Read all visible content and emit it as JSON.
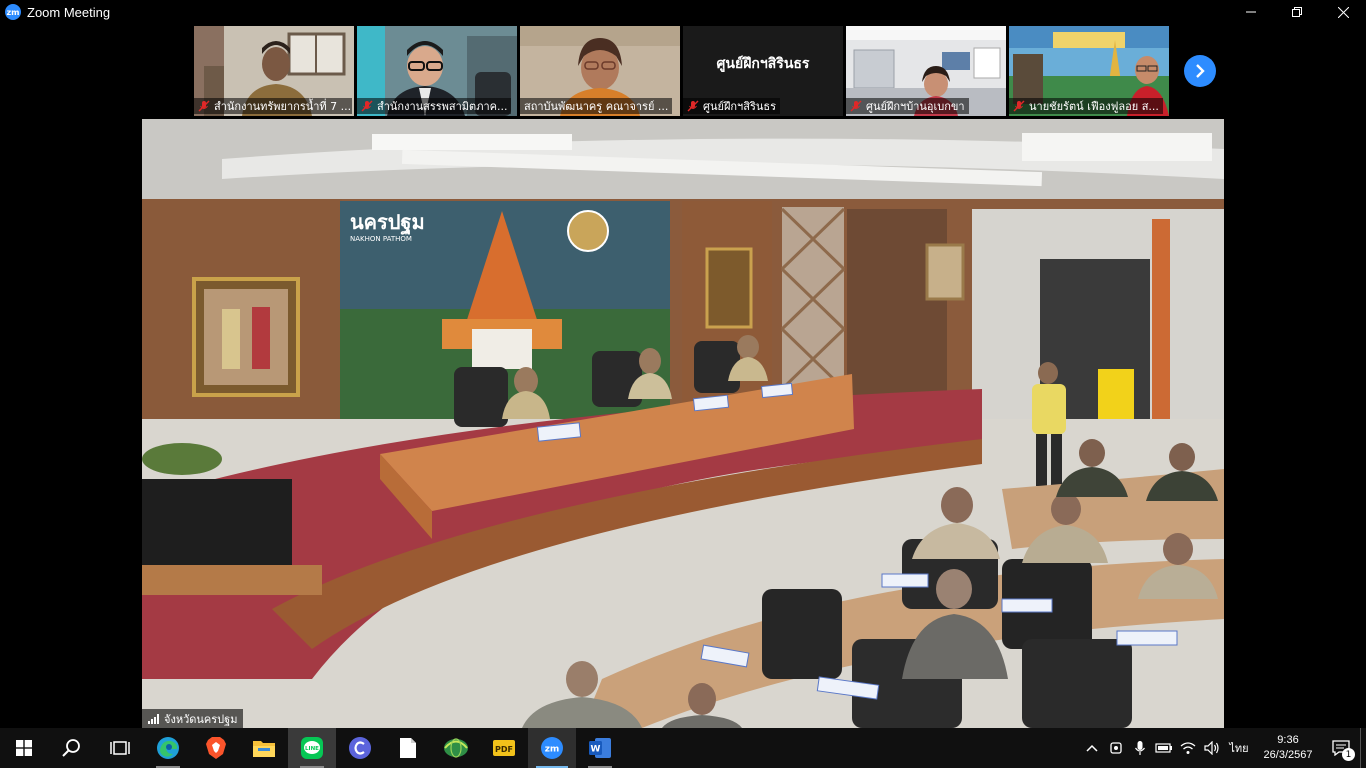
{
  "window": {
    "title": "Zoom Meeting",
    "logo_text": "zm"
  },
  "gallery": {
    "participants": [
      {
        "name": "สำนักงานทรัพยากรน้ำที่ 7 ..."
      },
      {
        "name": "สำนักงานสรรพสามิตภาค..."
      },
      {
        "name": "สถาบันพัฒนาครู คณาจารย์ ..."
      },
      {
        "name": "ศูนย์ฝึกฯสิรินธร",
        "display_text": "ศูนย์ฝึกฯสิรินธร"
      },
      {
        "name": "ศูนย์ฝึกฯบ้านอุเบกขา"
      },
      {
        "name": "นายชัยรัตน์ เฟืองฟูลอย ส..."
      }
    ]
  },
  "main_video": {
    "participant_name": "จังหวัดนครปฐม",
    "banner_title": "นครปฐม",
    "banner_subtitle": "NAKHON PATHOM"
  },
  "taskbar": {
    "time": "9:36",
    "date": "26/3/2567",
    "language": "ไทย",
    "notification_count": "1"
  },
  "colors": {
    "zoom_blue": "#2D8CFF",
    "mic_muted_red": "#E02828"
  }
}
